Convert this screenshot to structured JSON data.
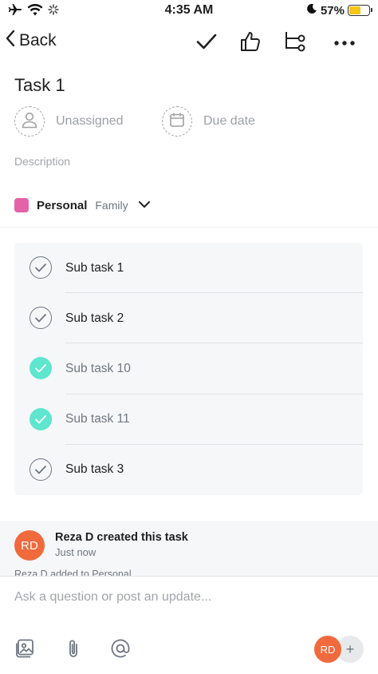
{
  "status_bar": {
    "time": "4:35 AM",
    "battery_percent": "57%",
    "battery_level": 0.57,
    "icons": [
      "airplane-icon",
      "wifi-icon",
      "activity-spinner-icon",
      "moon-icon",
      "battery-icon"
    ]
  },
  "nav": {
    "back_label": "Back",
    "actions": [
      "checkmark-icon",
      "thumbs-up-icon",
      "subtasks-icon",
      "more-icon"
    ]
  },
  "task": {
    "title": "Task 1",
    "assignee_label": "Unassigned",
    "due_date_label": "Due date",
    "description_placeholder": "Description",
    "project": {
      "name": "Personal",
      "section": "Family",
      "color": "#e362a8"
    }
  },
  "subtasks": [
    {
      "label": "Sub task 1",
      "completed": false
    },
    {
      "label": "Sub task 2",
      "completed": false
    },
    {
      "label": "Sub task 10",
      "completed": true
    },
    {
      "label": "Sub task 11",
      "completed": true
    },
    {
      "label": "Sub task 3",
      "completed": false
    }
  ],
  "activity": {
    "avatar_initials": "RD",
    "title": "Reza D created this task",
    "time": "Just now",
    "next_entry": "Reza D added to Personal"
  },
  "composer": {
    "placeholder": "Ask a question or post an update...",
    "tools": [
      "photo-icon",
      "attachment-icon",
      "mention-icon"
    ],
    "collaborator_initials": "RD",
    "add_label": "+"
  },
  "colors": {
    "accent_complete": "#5ee6cf",
    "avatar": "#f06a3d",
    "project": "#e362a8",
    "battery": "#f5c518"
  }
}
